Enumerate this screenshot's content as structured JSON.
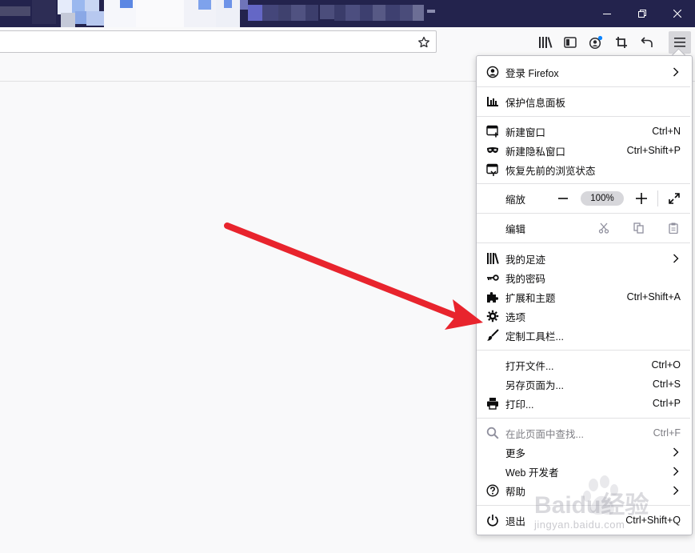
{
  "menu": {
    "login": "登录 Firefox",
    "protection_dashboard": "保护信息面板",
    "new_window": {
      "label": "新建窗口",
      "shortcut": "Ctrl+N"
    },
    "new_private_window": {
      "label": "新建隐私窗口",
      "shortcut": "Ctrl+Shift+P"
    },
    "restore_session": "恢复先前的浏览状态",
    "zoom": {
      "label": "缩放",
      "minus": "−",
      "value": "100%",
      "plus": "+"
    },
    "edit": "编辑",
    "library": "我的足迹",
    "logins": "我的密码",
    "addons": {
      "label": "扩展和主题",
      "shortcut": "Ctrl+Shift+A"
    },
    "options": "选项",
    "customize": "定制工具栏...",
    "open_file": {
      "label": "打开文件...",
      "shortcut": "Ctrl+O"
    },
    "save_page": {
      "label": "另存页面为...",
      "shortcut": "Ctrl+S"
    },
    "print": {
      "label": "打印...",
      "shortcut": "Ctrl+P"
    },
    "find": {
      "label": "在此页面中查找...",
      "shortcut": "Ctrl+F"
    },
    "more": "更多",
    "web_developer": "Web 开发者",
    "help": "帮助",
    "exit": {
      "label": "退出",
      "shortcut": "Ctrl+Shift+Q"
    }
  },
  "watermark": {
    "brand": "Baidu经验",
    "url": "jingyan.baidu.com"
  },
  "icons": {
    "library": "library-icon",
    "sidebar": "sidebar-icon",
    "account": "account-icon",
    "screenshot": "screenshot-icon",
    "undo": "undo-icon",
    "menu": "hamburger-menu-icon",
    "bookmark": "star-icon"
  },
  "colors": {
    "titlebar": "#23234d",
    "annotation_arrow": "#e8242d",
    "account_dot": "#0a84ff"
  }
}
